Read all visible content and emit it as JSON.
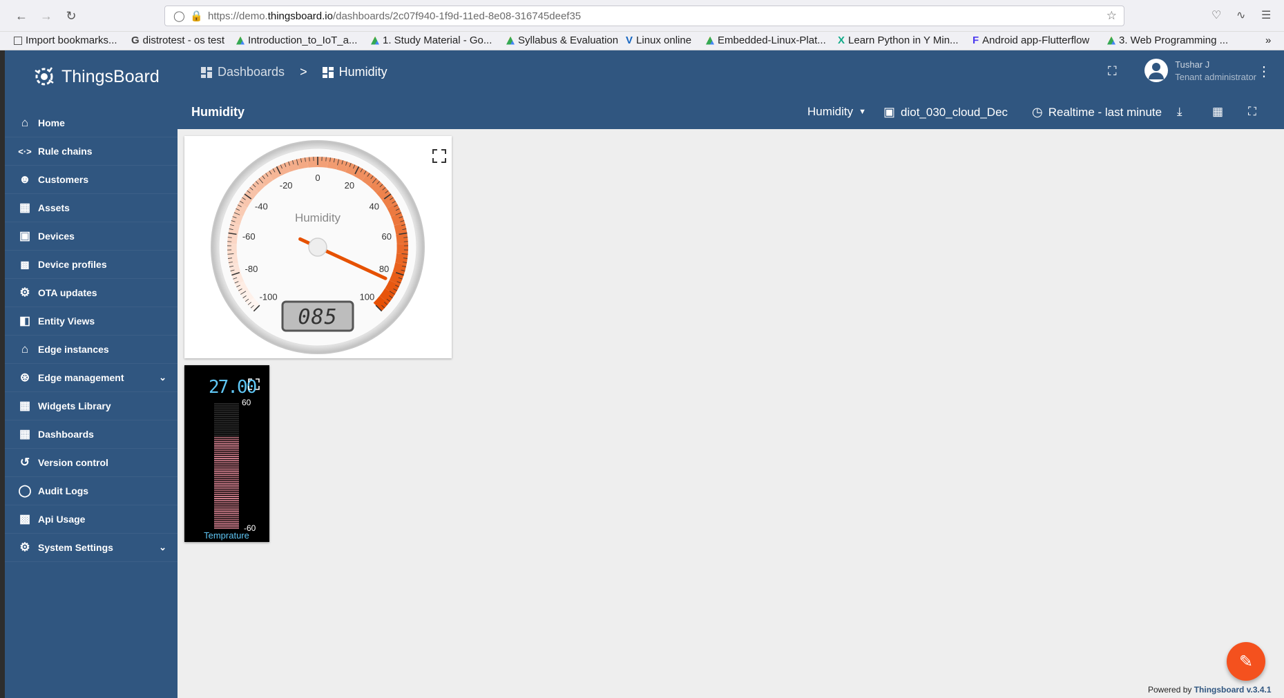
{
  "browser": {
    "url_prefix": "https://demo.",
    "url_domain": "thingsboard.io",
    "url_path": "/dashboards/2c07f940-1f9d-11ed-8e08-316745deef35",
    "bookmarks": [
      "Import bookmarks...",
      "distrotest - os test",
      "Introduction_to_IoT_a...",
      "1. Study Material - Go...",
      "Syllabus & Evaluation",
      "Linux online",
      "Embedded-Linux-Plat...",
      "Learn Python in Y Min...",
      "Android app-Flutterflow",
      "3. Web Programming ..."
    ]
  },
  "app": {
    "name": "ThingsBoard"
  },
  "sidebar": {
    "items": [
      {
        "label": "Home",
        "icon": "home-icon"
      },
      {
        "label": "Rule chains",
        "icon": "rule-chain-icon"
      },
      {
        "label": "Customers",
        "icon": "customers-icon"
      },
      {
        "label": "Assets",
        "icon": "assets-icon"
      },
      {
        "label": "Devices",
        "icon": "devices-icon"
      },
      {
        "label": "Device profiles",
        "icon": "device-profile-icon"
      },
      {
        "label": "OTA updates",
        "icon": "ota-icon"
      },
      {
        "label": "Entity Views",
        "icon": "entity-views-icon"
      },
      {
        "label": "Edge instances",
        "icon": "router-icon"
      },
      {
        "label": "Edge management",
        "icon": "antenna-icon"
      },
      {
        "label": "Widgets Library",
        "icon": "widgets-icon"
      },
      {
        "label": "Dashboards",
        "icon": "dashboard-icon"
      },
      {
        "label": "Version control",
        "icon": "history-icon"
      },
      {
        "label": "Audit Logs",
        "icon": "audit-icon"
      },
      {
        "label": "Api Usage",
        "icon": "chart-icon"
      },
      {
        "label": "System Settings",
        "icon": "gear-icon"
      }
    ]
  },
  "header": {
    "breadcrumb_root": "Dashboards",
    "breadcrumb_sep": ">",
    "breadcrumb_current": "Humidity",
    "user_name": "Tushar J",
    "user_role": "Tenant administrator"
  },
  "toolbar": {
    "title": "Humidity",
    "state_select": "Humidity",
    "entity_alias": "diot_030_cloud_Dec",
    "timewindow": "Realtime - last minute"
  },
  "gauge": {
    "title": "Humidity",
    "value": 85,
    "display": "085",
    "min": -100,
    "max": 100,
    "tick_labels": [
      "-100",
      "-80",
      "-60",
      "-40",
      "-20",
      "0",
      "20",
      "40",
      "60",
      "80",
      "100"
    ]
  },
  "thermometer": {
    "value_display": "27.00",
    "value": 27,
    "max_label": "60",
    "min_label": "-60",
    "min": -60,
    "max": 60,
    "label": "Temprature"
  },
  "footer": {
    "powered_prefix": "Powered by",
    "powered_link": "Thingsboard v.3.4.1"
  }
}
